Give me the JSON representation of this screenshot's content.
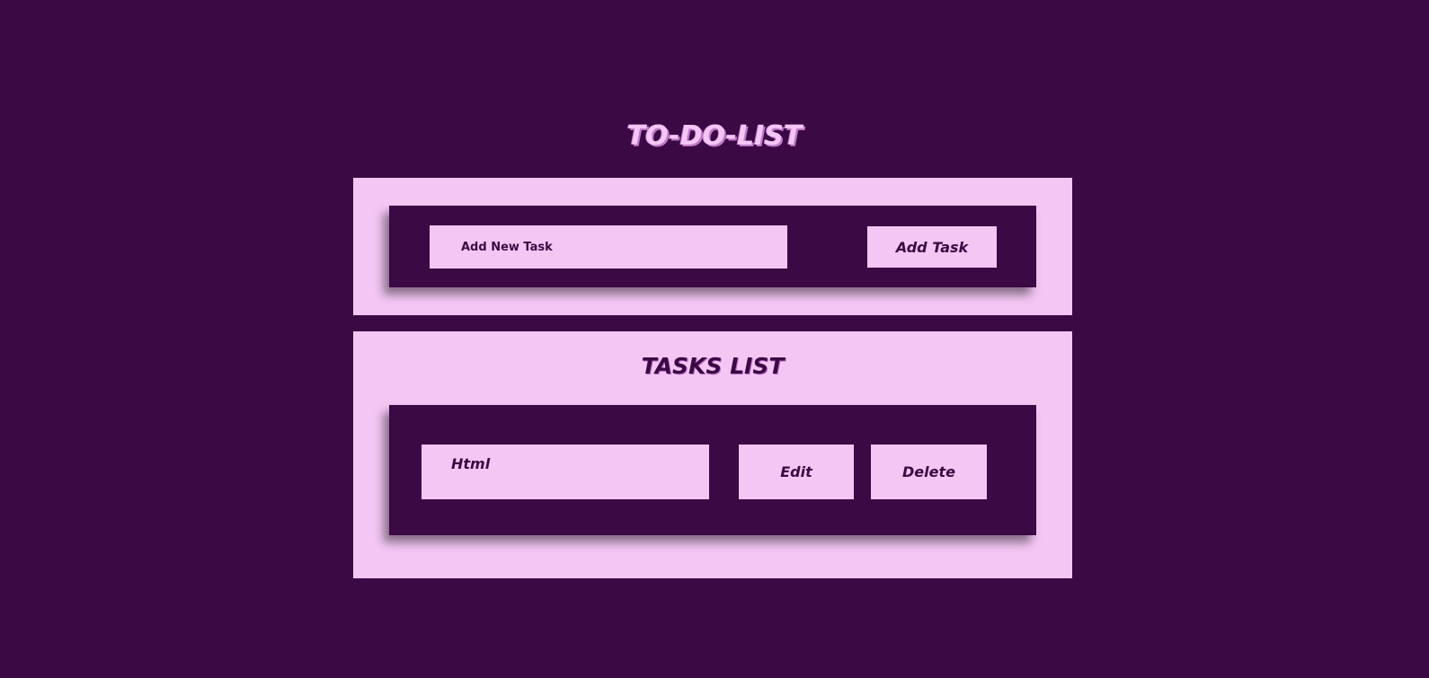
{
  "app": {
    "title": "TO-DO-LIST"
  },
  "add_task": {
    "input_placeholder": "Add New Task",
    "input_value": "",
    "button_label": "Add Task"
  },
  "tasks_list": {
    "heading": "TASKS LIST",
    "items": [
      {
        "text": "Html",
        "edit_label": "Edit",
        "delete_label": "Delete"
      }
    ]
  },
  "colors": {
    "background": "#3b0944",
    "panel": "#f3c6f4",
    "text_dark": "#3b0944",
    "title_light": "#f4c6f5"
  }
}
